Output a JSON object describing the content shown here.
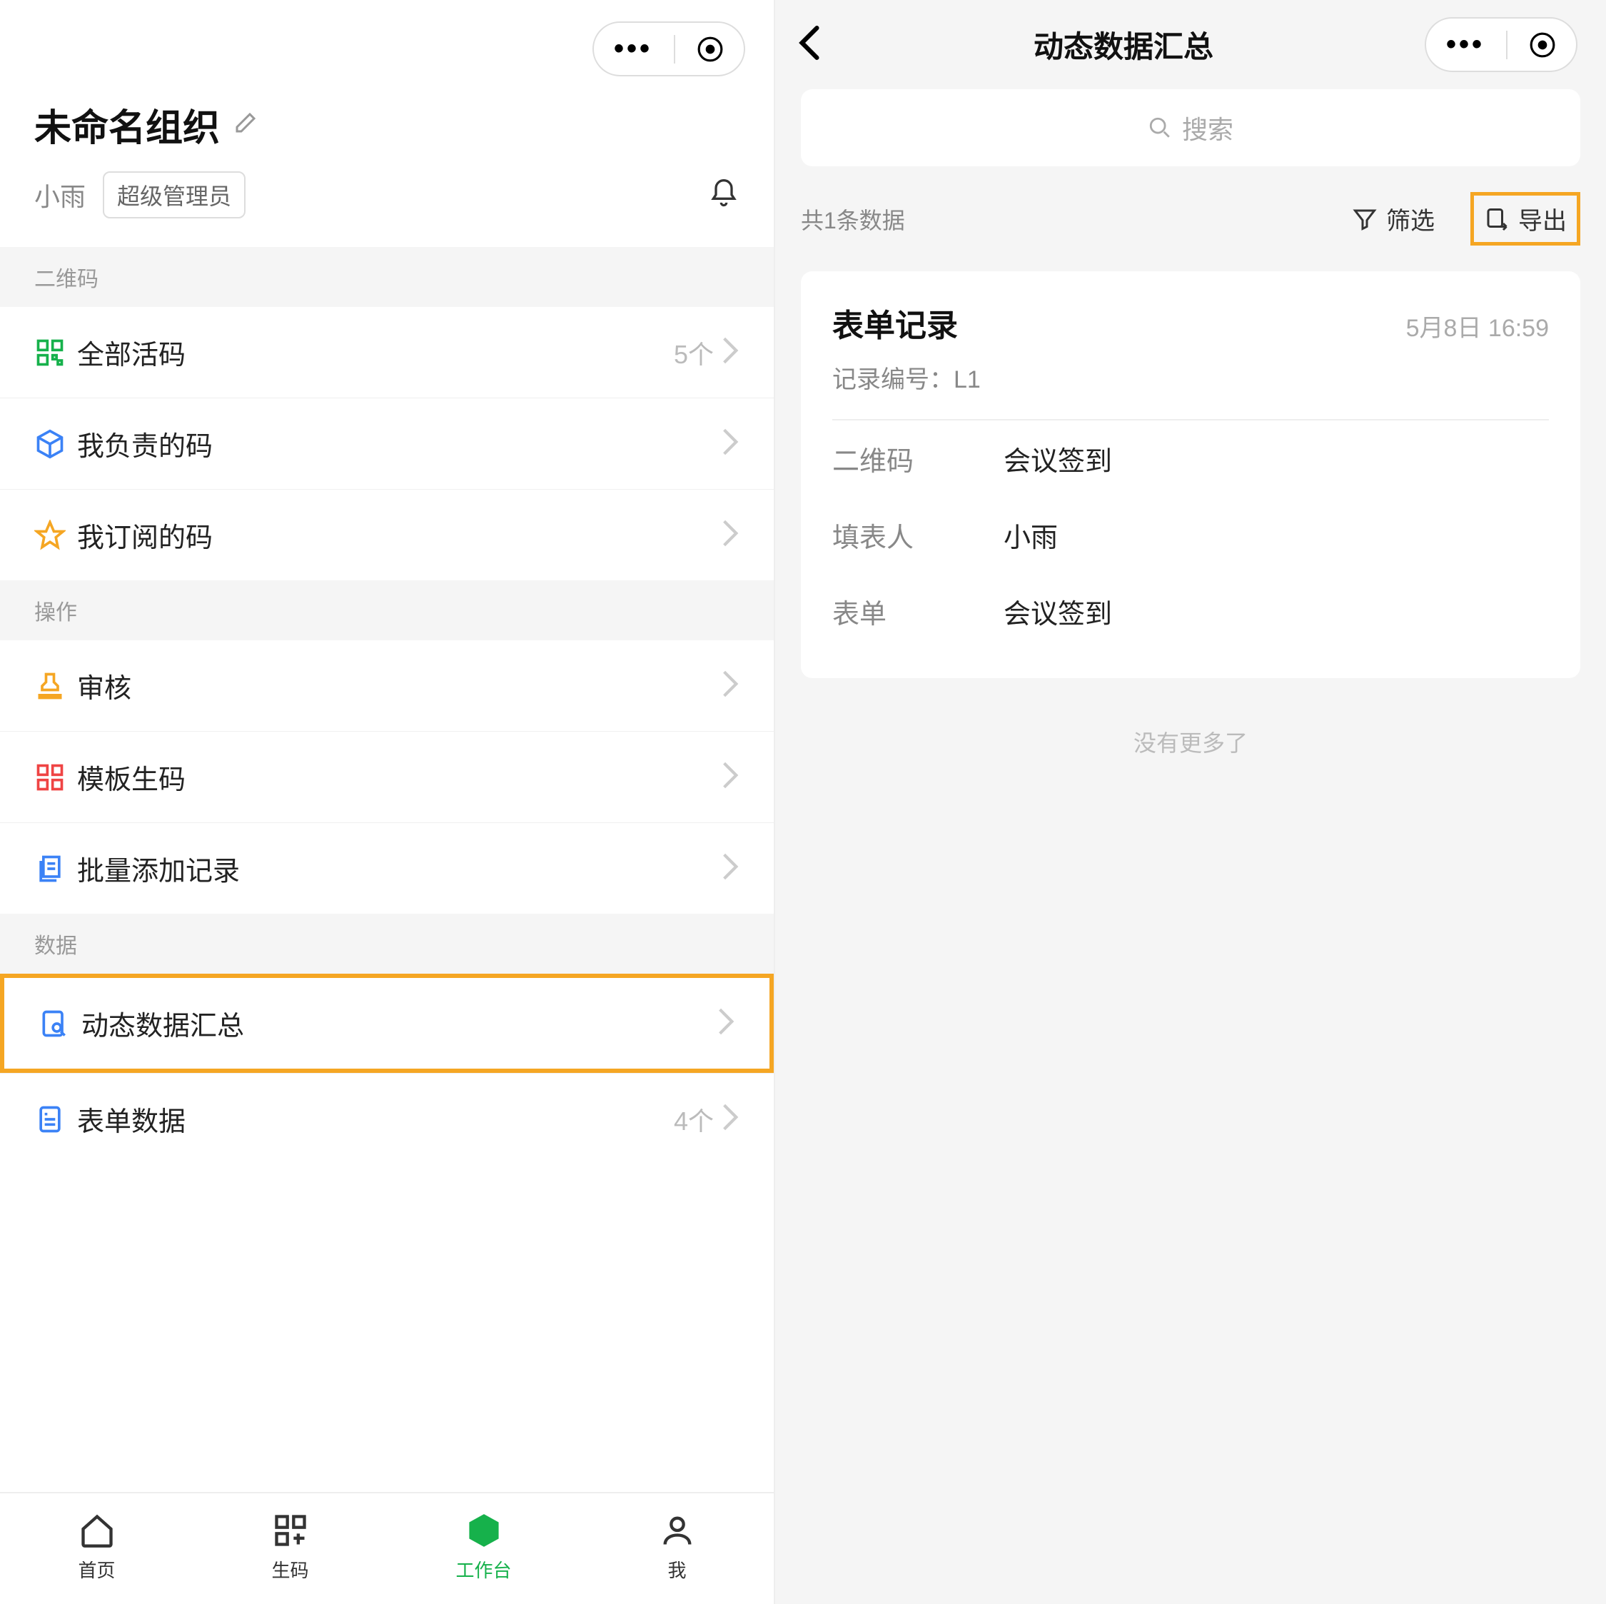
{
  "left": {
    "org_title": "未命名组织",
    "username": "小雨",
    "role": "超级管理员",
    "sections": {
      "qr": {
        "header": "二维码",
        "all_codes": "全部活码",
        "all_codes_count": "5个",
        "my_responsible": "我负责的码",
        "my_subscribed": "我订阅的码"
      },
      "ops": {
        "header": "操作",
        "review": "审核",
        "template_gen": "模板生码",
        "batch_add": "批量添加记录"
      },
      "data": {
        "header": "数据",
        "dynamic_summary": "动态数据汇总",
        "form_data": "表单数据",
        "form_data_count": "4个"
      }
    },
    "tabs": {
      "home": "首页",
      "gen": "生码",
      "workbench": "工作台",
      "me": "我"
    }
  },
  "right": {
    "title": "动态数据汇总",
    "search_placeholder": "搜索",
    "data_count": "共1条数据",
    "filter": "筛选",
    "export": "导出",
    "card": {
      "title": "表单记录",
      "time": "5月8日 16:59",
      "record_label": "记录编号：",
      "record_no": "L1",
      "rows": {
        "qr_key": "二维码",
        "qr_val": "会议签到",
        "filler_key": "填表人",
        "filler_val": "小雨",
        "form_key": "表单",
        "form_val": "会议签到"
      }
    },
    "no_more": "没有更多了"
  }
}
